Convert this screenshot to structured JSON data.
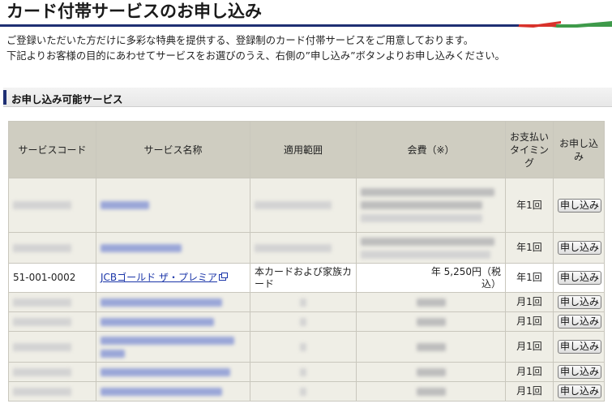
{
  "page": {
    "title": "カード付帯サービスのお申し込み",
    "intro_line1": "ご登録いただいた方だけに多彩な特典を提供する、登録制のカード付帯サービスをご用意しております。",
    "intro_line2": "下記よりお客様の目的にあわせてサービスをお選びのうえ、右側の”申し込み”ボタンよりお申し込みください。"
  },
  "section": {
    "title": "お申し込み可能サービス"
  },
  "table": {
    "headers": {
      "code": "サービスコード",
      "name": "サービス名称",
      "scope": "適用範囲",
      "fee": "会費（※）",
      "timing": "お支払いタイミング",
      "apply": "お申し込み"
    },
    "apply_label": "申し込み",
    "rows": [
      {
        "redacted": true,
        "timing": "年1回"
      },
      {
        "redacted": true,
        "timing": "年1回"
      },
      {
        "redacted": false,
        "code": "51-001-0002",
        "name": "JCBゴールド ザ・プレミア",
        "scope": "本カードおよび家族カード",
        "fee": "年 5,250円（税込）",
        "timing": "年1回"
      },
      {
        "redacted": true,
        "timing": "月1回"
      },
      {
        "redacted": true,
        "timing": "月1回"
      },
      {
        "redacted": true,
        "timing": "月1回"
      },
      {
        "redacted": true,
        "timing": "月1回"
      },
      {
        "redacted": true,
        "timing": "月1回"
      }
    ]
  },
  "colors": {
    "navy": "#1e2f73",
    "red": "#d8322b",
    "green": "#3e9a4a",
    "header_bg": "#cfcdc1",
    "row_bg": "#efeee6"
  }
}
